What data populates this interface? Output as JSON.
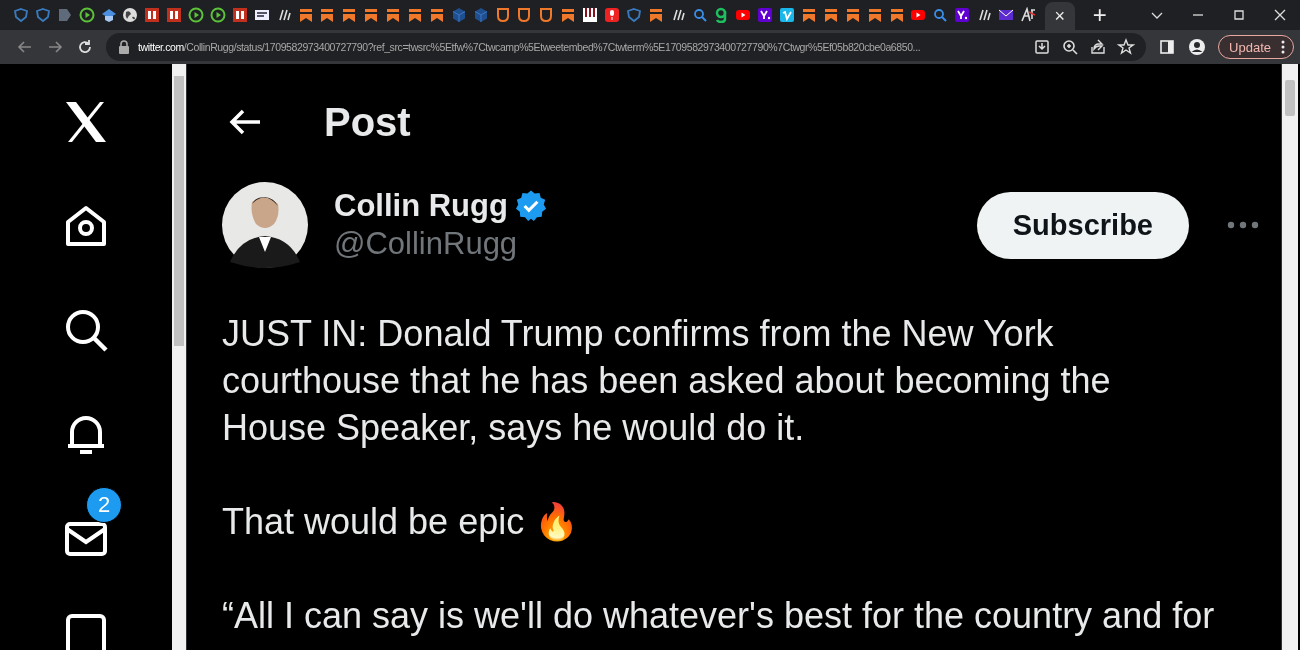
{
  "browser": {
    "tabs": [
      {
        "kind": "shield"
      },
      {
        "kind": "shield"
      },
      {
        "kind": "doc"
      },
      {
        "kind": "play"
      },
      {
        "kind": "cap"
      },
      {
        "kind": "globe"
      },
      {
        "kind": "bi"
      },
      {
        "kind": "bi"
      },
      {
        "kind": "play"
      },
      {
        "kind": "play"
      },
      {
        "kind": "bi"
      },
      {
        "kind": "news"
      },
      {
        "kind": "ll"
      },
      {
        "kind": "bookmark"
      },
      {
        "kind": "bookmark"
      },
      {
        "kind": "bookmark"
      },
      {
        "kind": "bookmark"
      },
      {
        "kind": "bookmark"
      },
      {
        "kind": "bookmark"
      },
      {
        "kind": "bookmark"
      },
      {
        "kind": "cube"
      },
      {
        "kind": "cube"
      },
      {
        "kind": "pocket"
      },
      {
        "kind": "pocket"
      },
      {
        "kind": "pocket"
      },
      {
        "kind": "bookmark"
      },
      {
        "kind": "piano"
      },
      {
        "kind": "mic"
      },
      {
        "kind": "shield"
      },
      {
        "kind": "bookmark"
      },
      {
        "kind": "ll"
      },
      {
        "kind": "search"
      },
      {
        "kind": "g"
      },
      {
        "kind": "youtube"
      },
      {
        "kind": "yahoo"
      },
      {
        "kind": "vimeo"
      },
      {
        "kind": "bookmark"
      },
      {
        "kind": "bookmark"
      },
      {
        "kind": "bookmark"
      },
      {
        "kind": "bookmark"
      },
      {
        "kind": "bookmark"
      },
      {
        "kind": "youtube"
      },
      {
        "kind": "search"
      },
      {
        "kind": "yahoo"
      },
      {
        "kind": "ll"
      },
      {
        "kind": "mail"
      },
      {
        "kind": "af"
      }
    ],
    "active_tab": {
      "close": "×"
    },
    "new_tab": "+",
    "address": {
      "host": "twitter.com",
      "path": "/CollinRugg/status/1709582973400727790?ref_src=twsrc%5Etfw%7Ctwcamp%5Etweetembed%7Ctwterm%5E1709582973400727790%7Ctwgr%5Ef05b820cbe0a6850..."
    },
    "update_button": "Update"
  },
  "sidebar": {
    "items": [
      {
        "kind": "x"
      },
      {
        "kind": "home"
      },
      {
        "kind": "search"
      },
      {
        "kind": "bell"
      },
      {
        "kind": "mail",
        "badge": "2"
      },
      {
        "kind": "list"
      }
    ]
  },
  "header": {
    "title": "Post"
  },
  "post": {
    "author": {
      "name": "Collin Rugg",
      "verified": true,
      "handle": "@CollinRugg"
    },
    "subscribe": "Subscribe",
    "paragraphs": [
      "JUST IN: Donald Trump confirms from the New York courthouse that he has been asked about becoming the House Speaker, says he would do it.",
      "That would be epic 🔥",
      "“All I can say is we'll do whatever's best for the country and for"
    ]
  }
}
